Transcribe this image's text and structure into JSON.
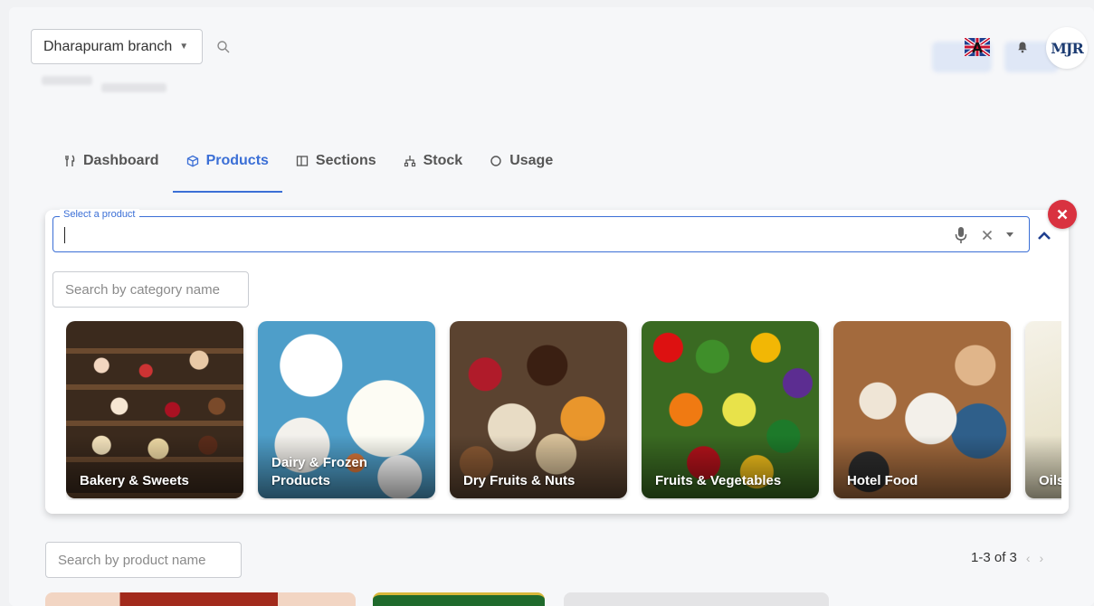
{
  "header": {
    "branch_label": "Dharapuram branch"
  },
  "avatar": {
    "initials": "MJR"
  },
  "tabs": [
    {
      "label": "Dashboard",
      "icon": "cutlery-icon"
    },
    {
      "label": "Products",
      "icon": "box-icon",
      "active": true
    },
    {
      "label": "Sections",
      "icon": "columns-icon"
    },
    {
      "label": "Stock",
      "icon": "hierarchy-icon"
    },
    {
      "label": "Usage",
      "icon": "circle-icon"
    }
  ],
  "product_select": {
    "legend": "Select a product",
    "value": ""
  },
  "category_search": {
    "placeholder": "Search by category name"
  },
  "categories": [
    {
      "label": "Bakery & Sweets"
    },
    {
      "label": "Dairy & Frozen Products"
    },
    {
      "label": "Dry Fruits & Nuts"
    },
    {
      "label": "Fruits & Vegetables"
    },
    {
      "label": "Hotel Food"
    },
    {
      "label": "Oils"
    }
  ],
  "product_search": {
    "placeholder": "Search by product name"
  },
  "pagination": {
    "range": "1-3 of 3"
  },
  "colors": {
    "accent": "#3b6fd6",
    "close_red": "#d93240"
  }
}
